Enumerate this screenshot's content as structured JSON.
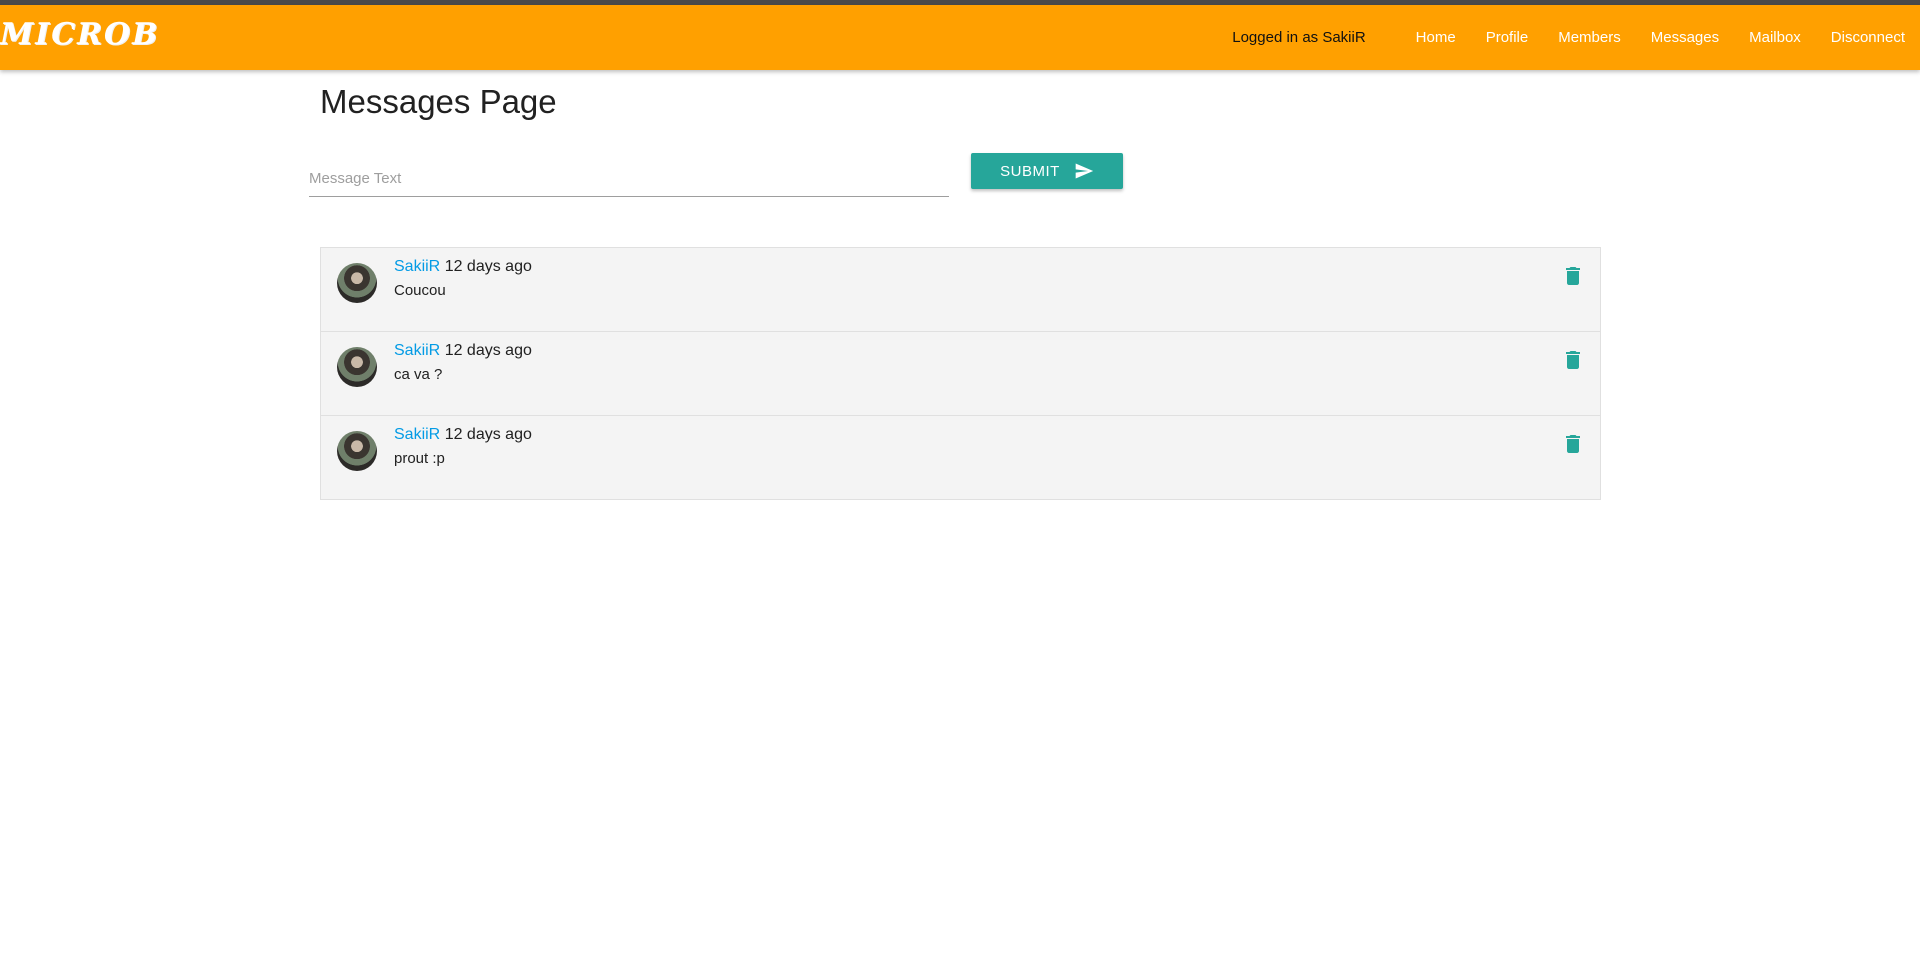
{
  "header": {
    "logo_text": "MICROB",
    "logged_in_text": "Logged in as SakiiR",
    "nav": [
      {
        "label": "Home"
      },
      {
        "label": "Profile"
      },
      {
        "label": "Members"
      },
      {
        "label": "Messages"
      },
      {
        "label": "Mailbox"
      },
      {
        "label": "Disconnect"
      }
    ]
  },
  "main": {
    "title": "Messages Page",
    "input": {
      "placeholder": "Message Text",
      "value": ""
    },
    "submit_label": "SUBMIT",
    "messages": [
      {
        "author": "SakiiR",
        "time": "12 days ago",
        "text": "Coucou"
      },
      {
        "author": "SakiiR",
        "time": "12 days ago",
        "text": "ca va ?"
      },
      {
        "author": "SakiiR",
        "time": "12 days ago",
        "text": "prout :p"
      }
    ]
  },
  "colors": {
    "navbar": "#ffa000",
    "accent": "#26a69a",
    "link": "#039be5"
  },
  "icons": {
    "submit": "send-icon",
    "delete": "trash-icon"
  }
}
